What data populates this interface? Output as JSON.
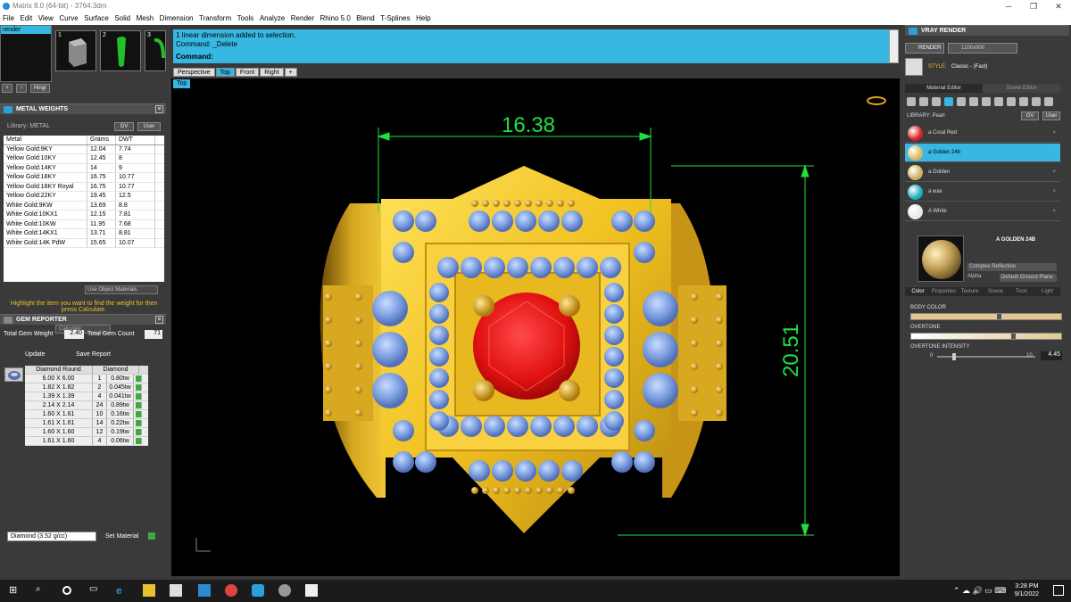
{
  "window": {
    "title": "Matrix 8.0 (64-bit) - 3764.3dm"
  },
  "menu": [
    "File",
    "Edit",
    "View",
    "Curve",
    "Surface",
    "Solid",
    "Mesh",
    "Dimension",
    "Transform",
    "Tools",
    "Analyze",
    "Render",
    "Rhino 5.0",
    "Blend",
    "T-Splines",
    "Help"
  ],
  "left": {
    "render_label": "render",
    "thumb_numbers": [
      "1",
      "2",
      "3"
    ],
    "hinge_label": "Hingr",
    "metal_weights": {
      "title": "METAL WEIGHTS",
      "library_label": "Library: METAL",
      "gv": "GV",
      "user": "User",
      "headers": [
        "Metal",
        "Grams",
        "DWT"
      ],
      "rows": [
        [
          "Yellow Gold:9KY",
          "12.04",
          "7.74"
        ],
        [
          "Yellow Gold:10KY",
          "12.45",
          "8"
        ],
        [
          "Yellow Gold:14KY",
          "14",
          "9"
        ],
        [
          "Yellow Gold:18KY",
          "16.75",
          "10.77"
        ],
        [
          "Yellow Gold:18KY Royal",
          "16.75",
          "10.77"
        ],
        [
          "Yellow Gold:22KY",
          "19.45",
          "12.5"
        ],
        [
          "White Gold:9KW",
          "13.69",
          "8.8"
        ],
        [
          "White Gold:10KX1",
          "12.15",
          "7.81"
        ],
        [
          "White Gold:10KW",
          "11.95",
          "7.68"
        ],
        [
          "White Gold:14KX1",
          "13.71",
          "8.81"
        ],
        [
          "White Gold:14K PdW",
          "15.65",
          "10.07"
        ]
      ],
      "use_object_materials": "Use Object Materials",
      "hint": "Highlight the item you want to find the weight for then press Calculate.",
      "calculate": "Calculate"
    },
    "gem_reporter": {
      "title": "GEM REPORTER",
      "total_weight_label": "Total Gem Weight",
      "total_weight": "2.40",
      "total_count_label": "Total Gem Count",
      "total_count": "71",
      "update": "Update",
      "save_report": "Save Report",
      "headers": [
        "Diamond Round",
        "Diamond"
      ],
      "rows": [
        [
          "6.00 X 6.00",
          "1",
          "0.80tw"
        ],
        [
          "1.82 X 1.82",
          "2",
          "0.045tw"
        ],
        [
          "1.39 X 1.39",
          "4",
          "0.041tw"
        ],
        [
          "2.14 X 2.14",
          "24",
          "0.89tw"
        ],
        [
          "1.60 X 1.61",
          "10",
          "0.16tw"
        ],
        [
          "1.61 X 1.61",
          "14",
          "0.22tw"
        ],
        [
          "1.60 X 1.60",
          "12",
          "0.19tw"
        ],
        [
          "1.61 X 1.60",
          "4",
          "0.06tw"
        ]
      ],
      "material_select": "Diamond   (3.52 g/cc)",
      "set_material": "Set Material"
    }
  },
  "center": {
    "msg_line1": "1 linear dimension added to selection.",
    "msg_line2": "Command: _Delete",
    "command_label": "Command:",
    "tabs": [
      "Perspective",
      "Top",
      "Front",
      "Right",
      "+"
    ],
    "active_tab": "Top",
    "view_label": "Top",
    "dim_width": "16.38",
    "dim_height": "20.51"
  },
  "right": {
    "title": "VRAY RENDER",
    "render_btn": "RENDER",
    "resolution": "1200x900",
    "style_label": "STYLE:",
    "style_value": "Classic - (Fast)",
    "tab_material": "Material Editor",
    "tab_scene": "Scene Editor",
    "library_label": "LIBRARY: Pearl",
    "gv": "GV",
    "user": "User",
    "materials": [
      {
        "name": "a Coral Red",
        "color": "#d42020"
      },
      {
        "name": "a Golden 24b",
        "color": "#d8b860"
      },
      {
        "name": "a Golden",
        "color": "#d0b060"
      },
      {
        "name": "a wax",
        "color": "#18b0b8"
      },
      {
        "name": "A White",
        "color": "#e8e8e8"
      }
    ],
    "selected_material": "a Golden 24b",
    "preview_title": "A GOLDEN 24B",
    "complex_reflection": "Complex Reflection",
    "alpha_label": "Alpha",
    "ground_plane": "Default Ground Plane",
    "prop_tabs": [
      "Color",
      "Properties",
      "Texture",
      "Scene",
      "Toon",
      "Light"
    ],
    "body_color": "BODY COLOR",
    "overtone": "OVERTONE",
    "overtone_intensity": "OVERTONE INTENSITY",
    "intensity_min": "0",
    "intensity_max": "10",
    "intensity_value": "4.45"
  },
  "taskbar": {
    "time": "3:28 PM",
    "date": "9/1/2022"
  }
}
